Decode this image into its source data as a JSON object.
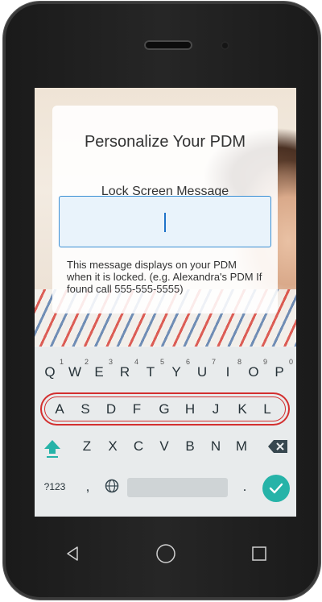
{
  "card": {
    "title": "Personalize Your PDM",
    "label": "Lock Screen Message",
    "help": "This message displays on your PDM when it is locked. (e.g. Alexandra's PDM If found call 555-555-5555)"
  },
  "input": {
    "value": ""
  },
  "keyboard": {
    "row1": [
      "Q",
      "W",
      "E",
      "R",
      "T",
      "Y",
      "U",
      "I",
      "O",
      "P"
    ],
    "row1_hints": [
      "1",
      "2",
      "3",
      "4",
      "5",
      "6",
      "7",
      "8",
      "9",
      "0"
    ],
    "row2": [
      "A",
      "S",
      "D",
      "F",
      "G",
      "H",
      "J",
      "K",
      "L"
    ],
    "row3": [
      "Z",
      "X",
      "C",
      "V",
      "B",
      "N",
      "M"
    ],
    "symbols_label": "?123",
    "comma": ",",
    "period": ".",
    "accent_color": "#26b3a8",
    "highlight_color": "#d32f2f"
  },
  "nav": {
    "icons": [
      "back-icon",
      "home-icon",
      "recents-icon"
    ]
  }
}
